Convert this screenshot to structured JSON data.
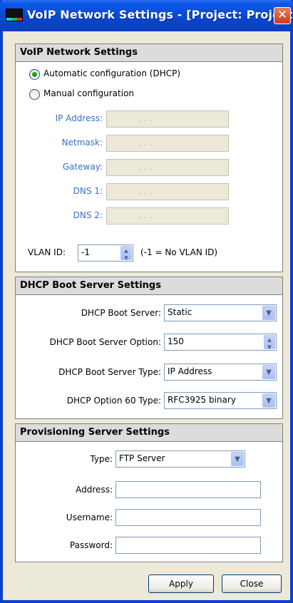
{
  "window": {
    "title": "VoIP Network Settings - [Project: Project...",
    "close_glyph": "✕"
  },
  "voip": {
    "header": "VoIP Network Settings",
    "radio_auto": "Automatic configuration (DHCP)",
    "radio_manual": "Manual configuration",
    "selected_mode": "auto",
    "ip_label": "IP Address:",
    "netmask_label": "Netmask:",
    "gateway_label": "Gateway:",
    "dns1_label": "DNS 1:",
    "dns2_label": "DNS 2:",
    "ip_placeholder": ".   .   .",
    "vlan_label": "VLAN ID:",
    "vlan_value": "-1",
    "vlan_hint": "(-1 = No VLAN ID)"
  },
  "dhcp": {
    "header": "DHCP Boot Server Settings",
    "server_label": "DHCP Boot Server:",
    "server_value": "Static",
    "option_label": "DHCP Boot Server Option:",
    "option_value": "150",
    "type_label": "DHCP Boot Server Type:",
    "type_value": "IP Address",
    "opt60_label": "DHCP Option 60 Type:",
    "opt60_value": "RFC3925 binary"
  },
  "prov": {
    "header": "Provisioning Server Settings",
    "type_label": "Type:",
    "type_value": "FTP Server",
    "address_label": "Address:",
    "address_value": "",
    "username_label": "Username:",
    "username_value": "",
    "password_label": "Password:",
    "password_value": ""
  },
  "footer": {
    "apply_label": "Apply",
    "close_label": "Close"
  },
  "icons": {
    "dropdown": "chevron-down-icon",
    "spinner": "spinner-arrows-icon",
    "app": "app-icon",
    "close": "close-icon"
  },
  "colors": {
    "titlebar": "#0b58e8",
    "window_frame": "#0a3fcf",
    "disabled_label": "#3a6ec8",
    "close_button": "#d33a15"
  }
}
